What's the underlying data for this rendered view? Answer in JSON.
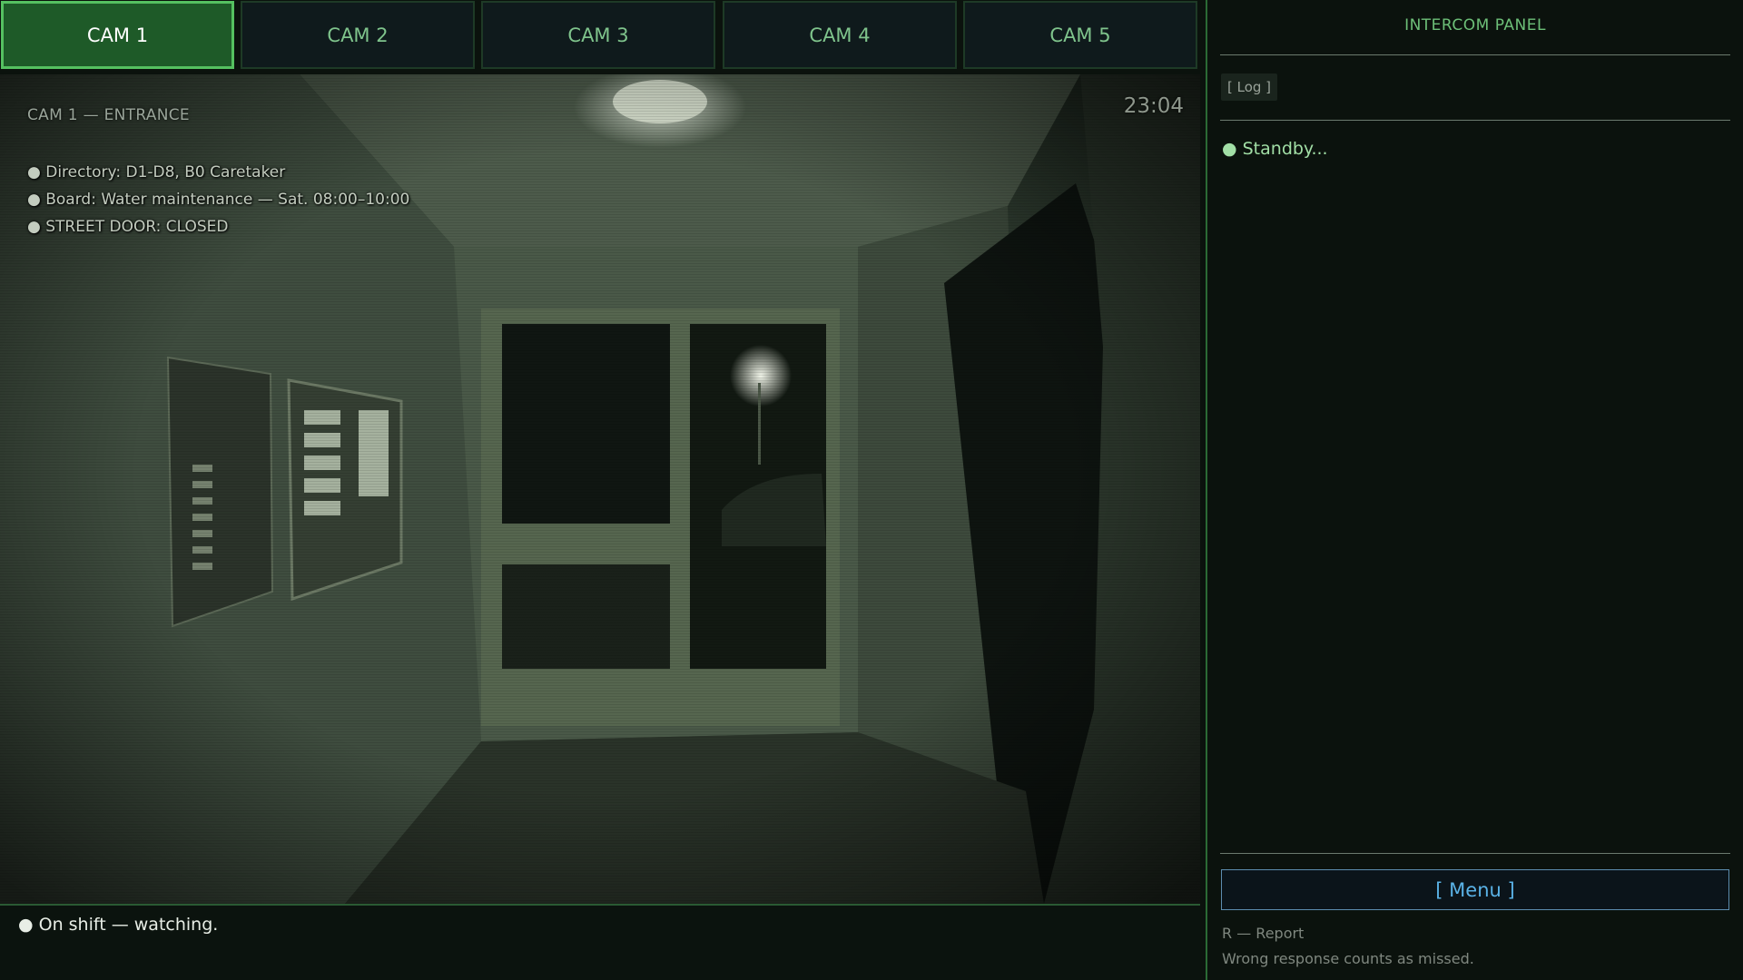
{
  "camera_tabs": [
    {
      "label": "CAM 1",
      "active": true
    },
    {
      "label": "CAM 2",
      "active": false
    },
    {
      "label": "CAM 3",
      "active": false
    },
    {
      "label": "CAM 4",
      "active": false
    },
    {
      "label": "CAM 5",
      "active": false
    }
  ],
  "camera": {
    "label": "CAM 1 — ENTRANCE",
    "time": "23:04",
    "info": [
      "● Directory: D1-D8, B0 Caretaker",
      "● Board: Water maintenance — Sat. 08:00–10:00",
      "● STREET DOOR: CLOSED"
    ]
  },
  "status": {
    "text": "● On shift — watching."
  },
  "panel": {
    "title": "INTERCOM PANEL",
    "log_label": "[ Log ]",
    "standby": "● Standby...",
    "menu_label": "[ Menu ]",
    "hint_report": "R — Report",
    "hint_wrong": "Wrong response counts as missed."
  },
  "colors": {
    "accent_green": "#55c060",
    "active_tab_bg": "#1e5a28",
    "menu_blue": "#5ab2e6",
    "panel_title": "#6dbf78"
  }
}
